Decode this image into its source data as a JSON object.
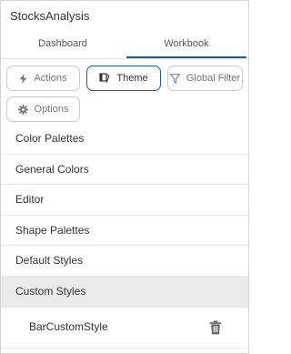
{
  "app": {
    "title": "StocksAnalysis"
  },
  "tabs": [
    {
      "label": "Dashboard"
    },
    {
      "label": "Workbook"
    }
  ],
  "buttons": {
    "actions": "Actions",
    "theme": "Theme",
    "global_filter": "Global Filter",
    "options": "Options"
  },
  "list": [
    {
      "label": "Color Palettes"
    },
    {
      "label": "General Colors"
    },
    {
      "label": "Editor"
    },
    {
      "label": "Shape Palettes"
    },
    {
      "label": "Default Styles"
    },
    {
      "label": "Custom Styles"
    }
  ],
  "custom_styles": {
    "items": [
      {
        "label": "BarCustomStyle"
      }
    ]
  },
  "colors": {
    "accent": "#1d5e8e",
    "selected_row_bg": "#ebebeb"
  },
  "icons": {
    "actions": "lightning-icon",
    "theme": "theme-icon",
    "global_filter": "filter-icon",
    "options": "gear-icon",
    "delete": "trash-icon"
  }
}
